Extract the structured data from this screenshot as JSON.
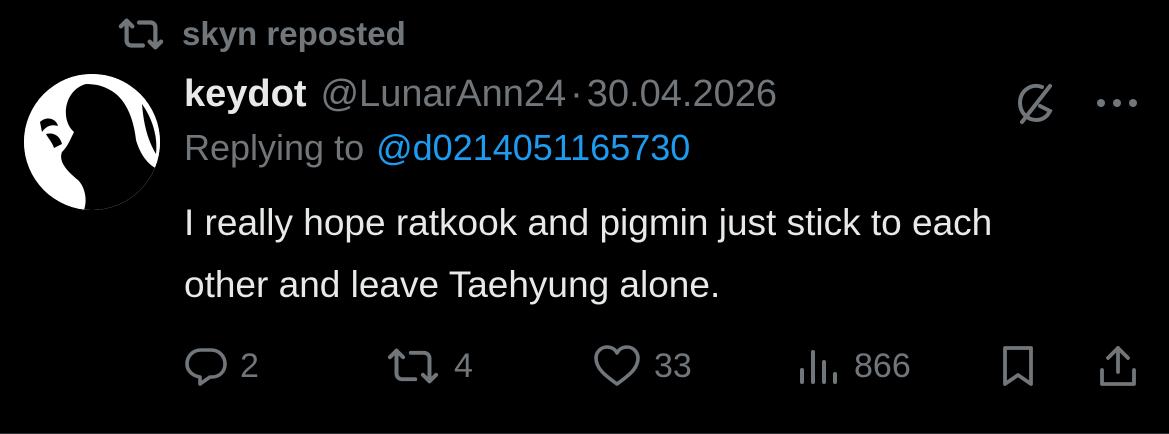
{
  "repost": {
    "text": "skyn reposted",
    "icon": "retweet-icon"
  },
  "tweet": {
    "display_name": "keydot",
    "handle": "@LunarAnn24",
    "separator": "·",
    "date": "30.04.2026",
    "replying_prefix": "Replying to",
    "replying_handle": "@d0214051165730",
    "text": "I really hope ratkook and pigmin just stick to each other and leave Taehyung alone."
  },
  "actions": {
    "replies": "2",
    "reposts": "4",
    "likes": "33",
    "views": "866"
  },
  "icons": {
    "grok": "grok-icon",
    "more": "more-icon",
    "reply": "reply-icon",
    "repost": "retweet-icon",
    "like": "heart-icon",
    "views": "analytics-icon",
    "bookmark": "bookmark-icon",
    "share": "share-icon"
  },
  "colors": {
    "background": "#000000",
    "text": "#e7e9ea",
    "muted": "#71767b",
    "link": "#1d9bf0"
  }
}
